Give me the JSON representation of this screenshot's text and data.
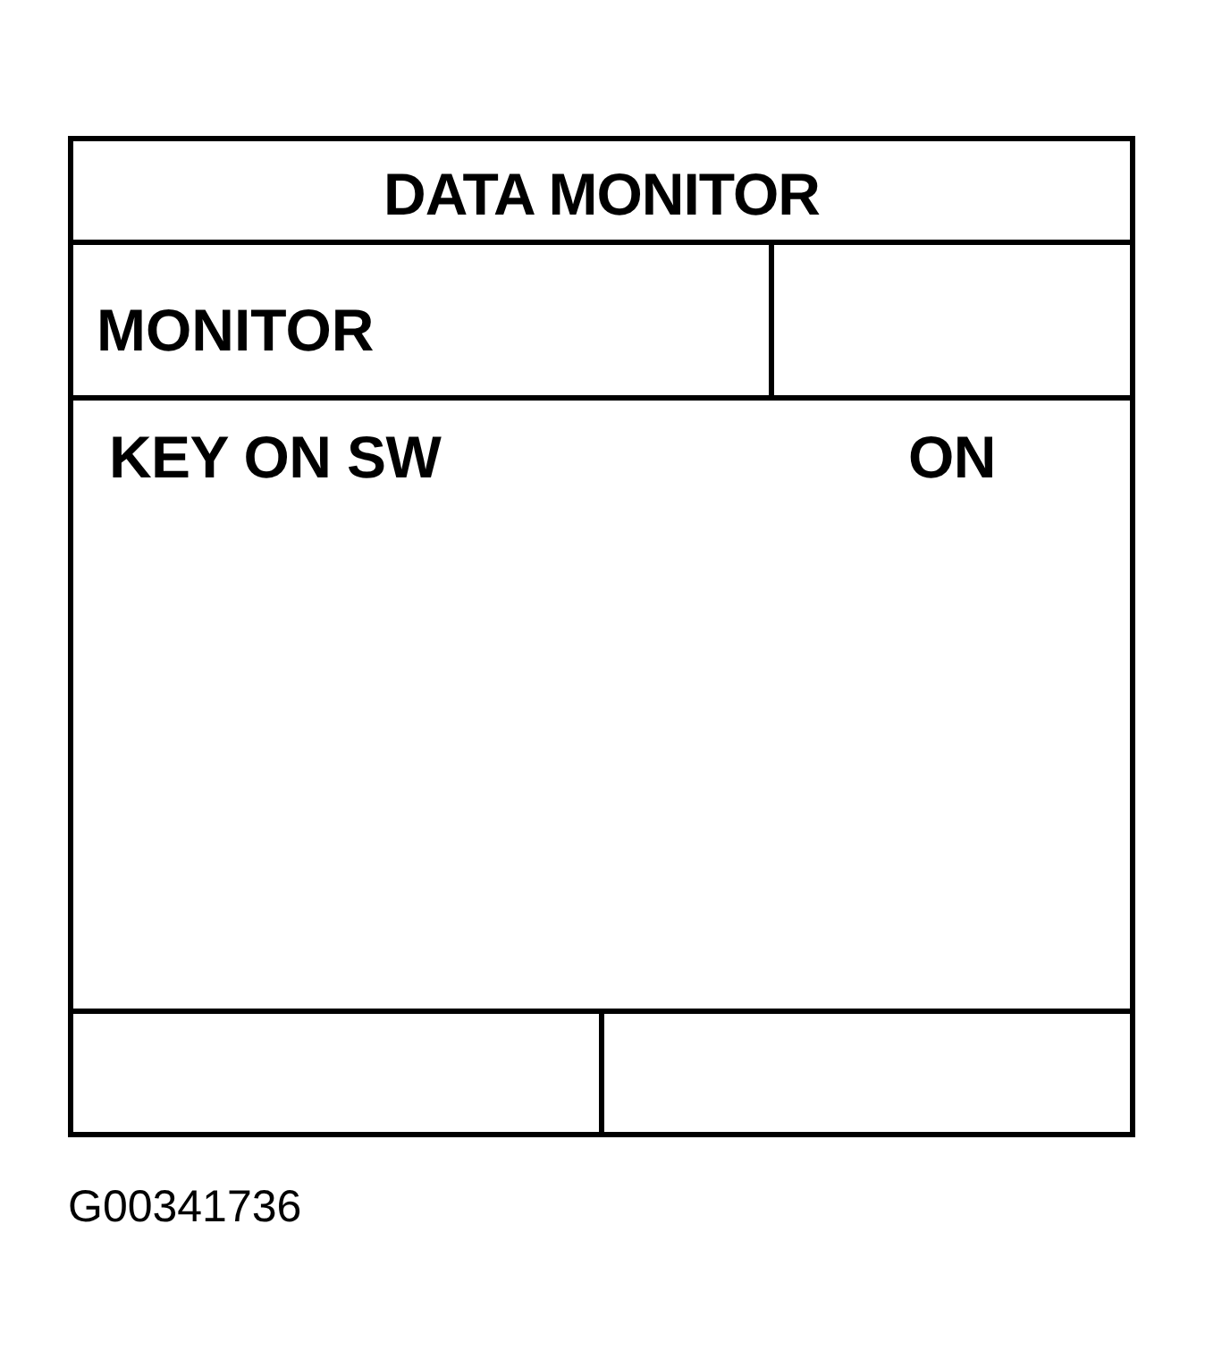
{
  "table": {
    "title": "DATA MONITOR",
    "header": {
      "column_1": "MONITOR"
    },
    "rows": [
      {
        "item": "KEY ON SW",
        "value": "ON"
      }
    ]
  },
  "figure_id": "G00341736"
}
